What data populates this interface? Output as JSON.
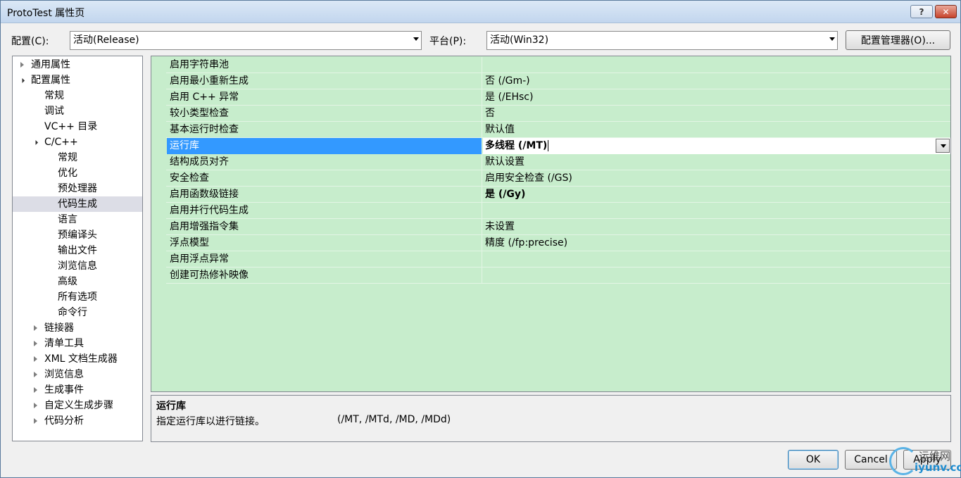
{
  "window": {
    "title": "ProtoTest 属性页",
    "help_label": "?",
    "close_label": "✕"
  },
  "toolbar": {
    "config_label": "配置(C):",
    "config_value": "活动(Release)",
    "platform_label": "平台(P):",
    "platform_value": "活动(Win32)",
    "config_manager_label": "配置管理器(O)..."
  },
  "tree": {
    "items": [
      {
        "label": "通用属性",
        "state": "collapsed"
      },
      {
        "label": "配置属性",
        "state": "expanded"
      },
      {
        "label": "常规"
      },
      {
        "label": "调试"
      },
      {
        "label": "VC++ 目录"
      },
      {
        "label": "C/C++",
        "state": "expanded"
      },
      {
        "label": "常规"
      },
      {
        "label": "优化"
      },
      {
        "label": "预处理器"
      },
      {
        "label": "代码生成",
        "selected": true
      },
      {
        "label": "语言"
      },
      {
        "label": "预编译头"
      },
      {
        "label": "输出文件"
      },
      {
        "label": "浏览信息"
      },
      {
        "label": "高级"
      },
      {
        "label": "所有选项"
      },
      {
        "label": "命令行"
      },
      {
        "label": "链接器",
        "state": "collapsed"
      },
      {
        "label": "清单工具",
        "state": "collapsed"
      },
      {
        "label": "XML 文档生成器",
        "state": "collapsed"
      },
      {
        "label": "浏览信息",
        "state": "collapsed"
      },
      {
        "label": "生成事件",
        "state": "collapsed"
      },
      {
        "label": "自定义生成步骤",
        "state": "collapsed"
      },
      {
        "label": "代码分析",
        "state": "collapsed"
      }
    ]
  },
  "properties": {
    "rows": [
      {
        "name": "启用字符串池",
        "value": ""
      },
      {
        "name": "启用最小重新生成",
        "value": "否 (/Gm-)"
      },
      {
        "name": "启用 C++ 异常",
        "value": "是 (/EHsc)"
      },
      {
        "name": "较小类型检查",
        "value": "否"
      },
      {
        "name": "基本运行时检查",
        "value": "默认值"
      },
      {
        "name": "运行库",
        "value": "多线程 (/MT)",
        "bold": true,
        "selected": true
      },
      {
        "name": "结构成员对齐",
        "value": "默认设置"
      },
      {
        "name": "安全检查",
        "value": "启用安全检查 (/GS)"
      },
      {
        "name": "启用函数级链接",
        "value": "是 (/Gy)",
        "bold": true
      },
      {
        "name": "启用并行代码生成",
        "value": ""
      },
      {
        "name": "启用增强指令集",
        "value": "未设置"
      },
      {
        "name": "浮点模型",
        "value": "精度 (/fp:precise)"
      },
      {
        "name": "启用浮点异常",
        "value": ""
      },
      {
        "name": "创建可热修补映像",
        "value": ""
      }
    ]
  },
  "description": {
    "title": "运行库",
    "text": "指定运行库以进行链接。",
    "options": "(/MT, /MTd, /MD, /MDd)"
  },
  "footer": {
    "ok_label": "OK",
    "cancel_label": "Cancel",
    "apply_label": "Apply"
  },
  "watermark": {
    "line1": "运维网",
    "line2": "iyunv.com"
  },
  "colors": {
    "grid_bg": "#c7edcc",
    "selection": "#3399ff",
    "tree_selection": "#dcdde6"
  }
}
